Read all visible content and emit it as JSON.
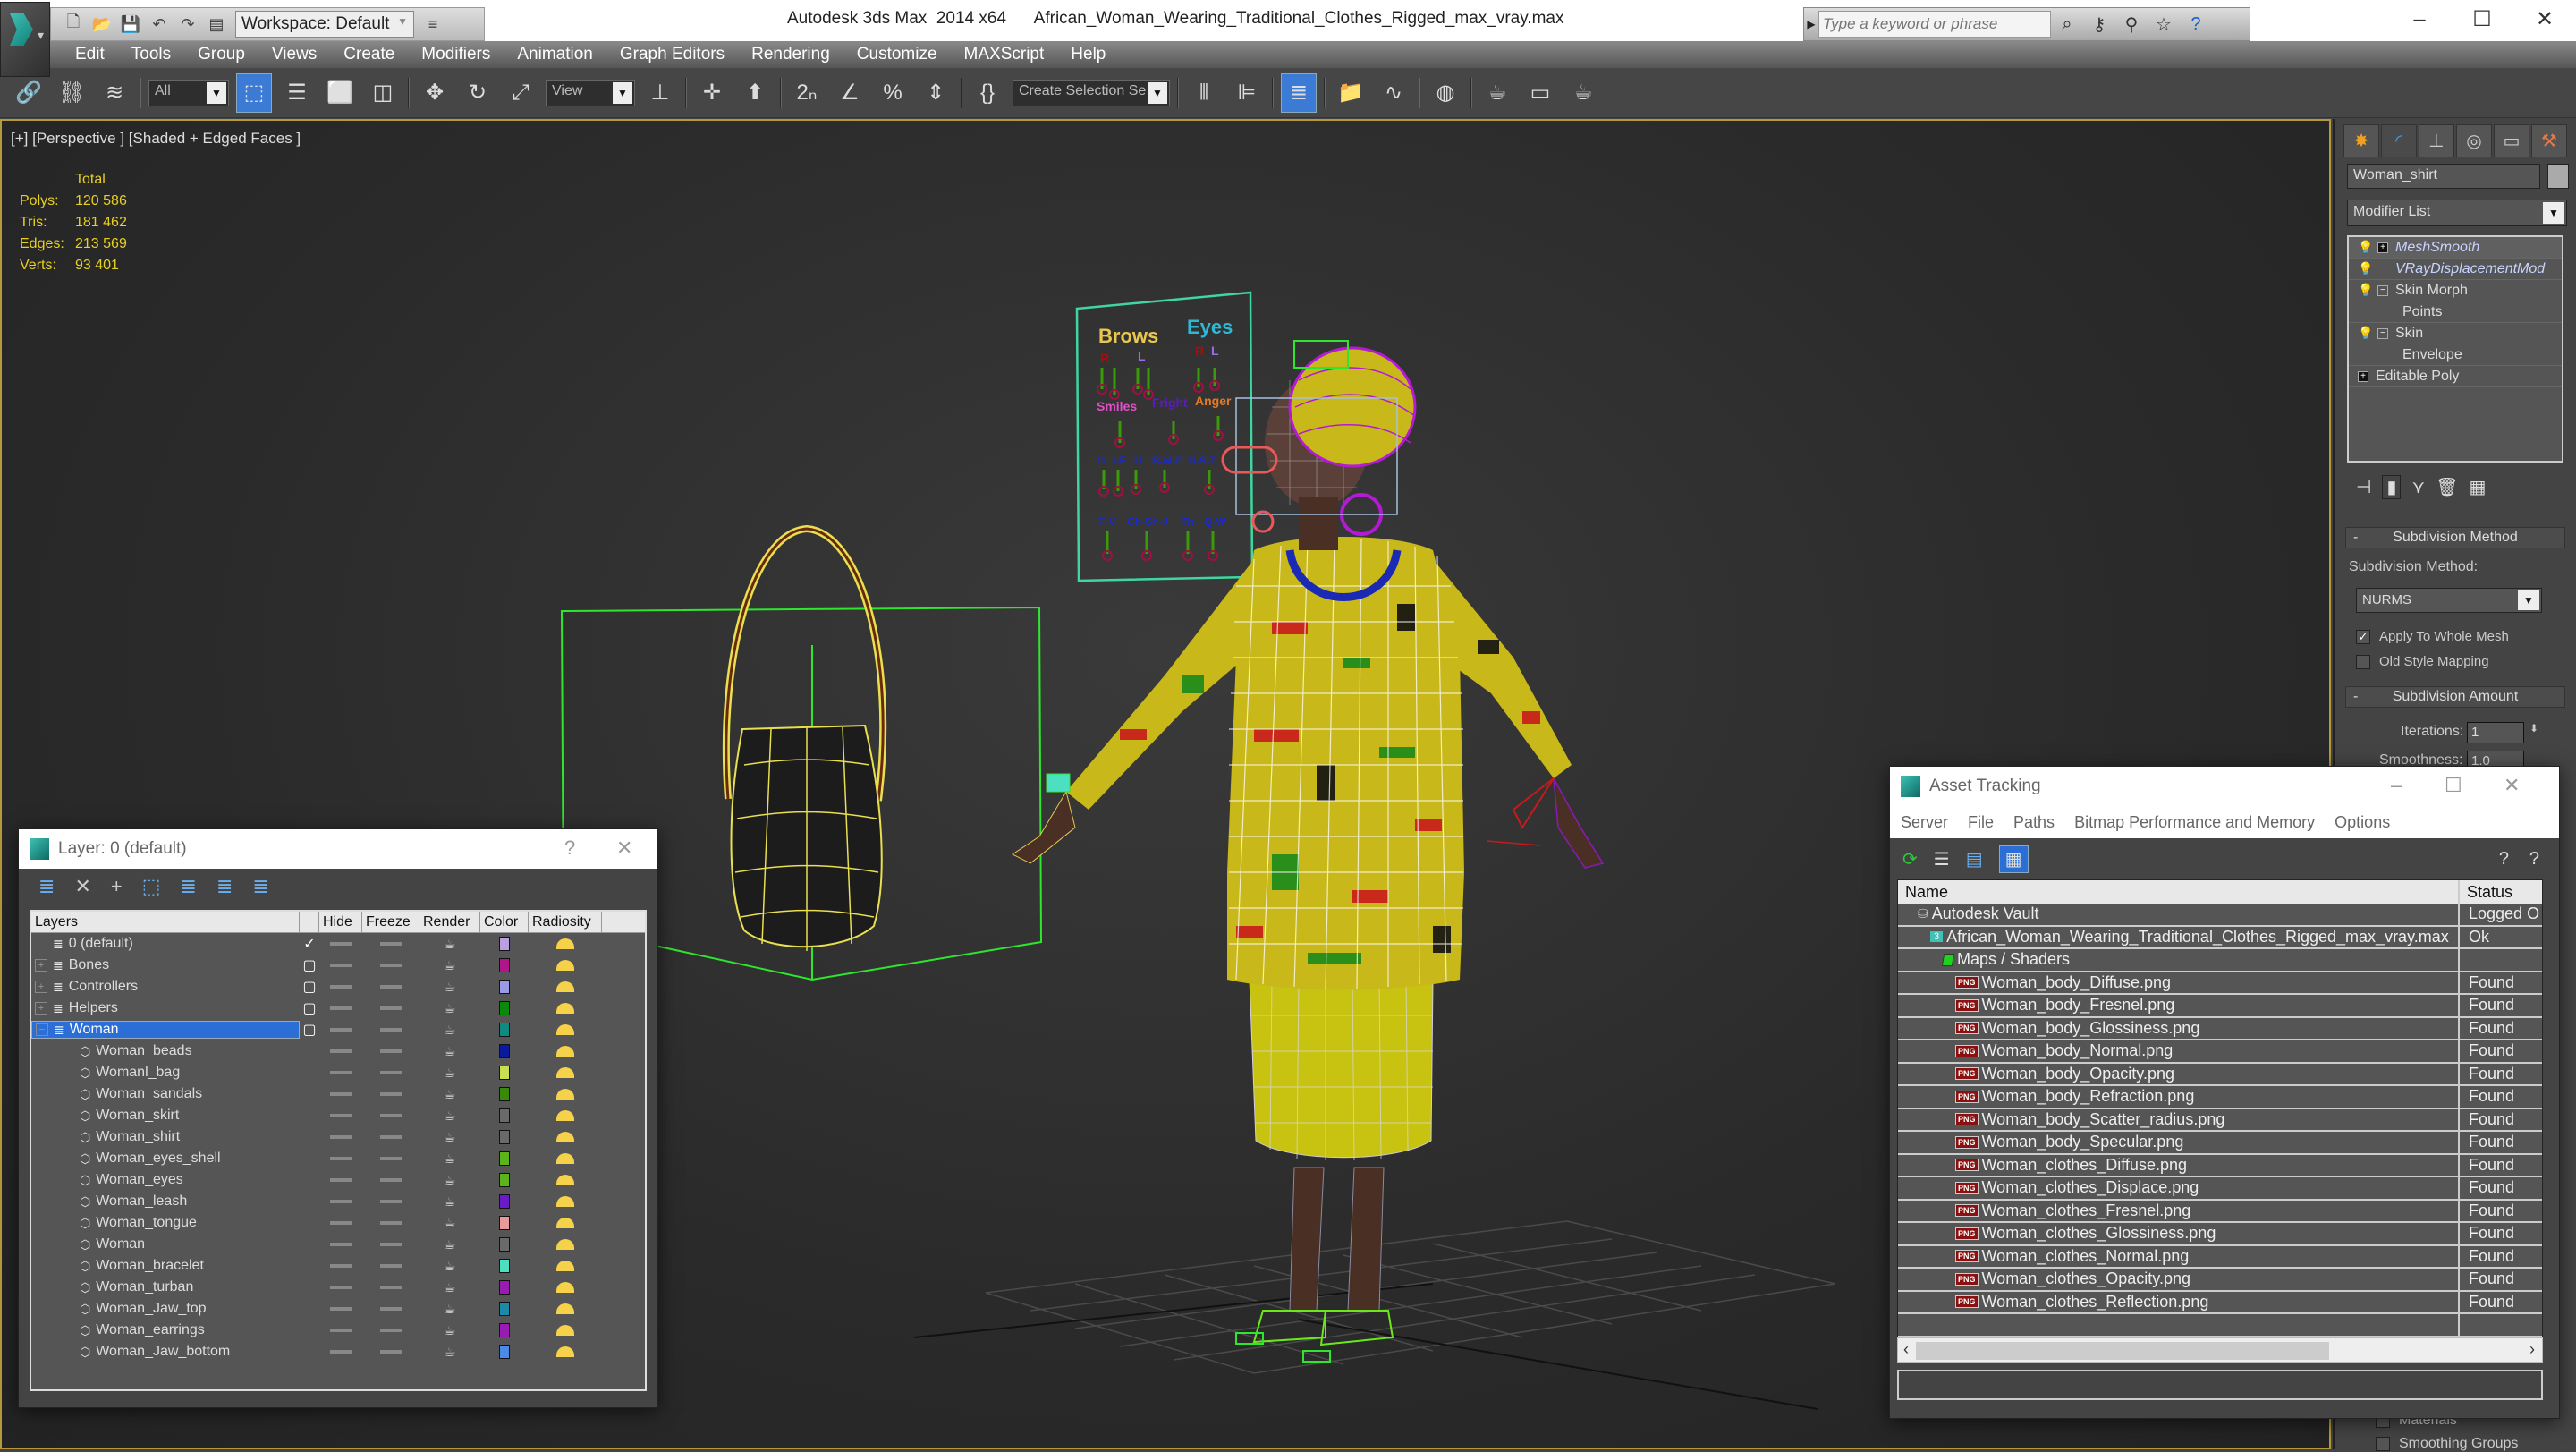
{
  "titlebar": {
    "app_title": "Autodesk 3ds Max  2014 x64",
    "file_name": "African_Woman_Wearing_Traditional_Clothes_Rigged_max_vray.max",
    "workspace": "Workspace: Default",
    "search_placeholder": "Type a keyword or phrase",
    "window_controls": [
      "–",
      "☐",
      "✕"
    ]
  },
  "menubar": {
    "items": [
      "Edit",
      "Tools",
      "Group",
      "Views",
      "Create",
      "Modifiers",
      "Animation",
      "Graph Editors",
      "Rendering",
      "Customize",
      "MAXScript",
      "Help"
    ]
  },
  "toolbar": {
    "selection_filter": "All",
    "reference_coord": "View",
    "named_selection": "Create Selection Se"
  },
  "viewport": {
    "label": "[+] [Perspective ] [Shaded + Edged Faces ]",
    "stats": {
      "header": "Total",
      "rows": [
        {
          "label": "Polys:",
          "value": "120 586"
        },
        {
          "label": "Tris:",
          "value": "181 462"
        },
        {
          "label": "Edges:",
          "value": "213 569"
        },
        {
          "label": "Verts:",
          "value": "93 401"
        }
      ]
    },
    "face_rig": {
      "brows": "Brows",
      "eyes": "Eyes",
      "r": "R",
      "l": "L",
      "smiles": "Smiles",
      "fright": "Fright",
      "anger": "Anger",
      "visemes_row1": [
        "O",
        "I-E",
        "U",
        "B-M-P",
        "D-S-T"
      ],
      "visemes_row2": [
        "F-V",
        "Ch-Sh-J",
        "Th",
        "Q-W"
      ]
    }
  },
  "command_panel": {
    "object_name": "Woman_shirt",
    "modifier_list": "Modifier List",
    "stack": [
      {
        "label": "MeshSmooth",
        "italic": true,
        "toggle": "+"
      },
      {
        "label": "VRayDisplacementMod",
        "italic": true,
        "toggle": ""
      },
      {
        "label": "Skin Morph",
        "italic": false,
        "toggle": "−"
      },
      {
        "label": "Points",
        "sub": true
      },
      {
        "label": "Skin",
        "italic": false,
        "toggle": "−"
      },
      {
        "label": "Envelope",
        "sub": true
      },
      {
        "label": "Editable Poly",
        "italic": false,
        "toggle": "+",
        "nobulb": true
      }
    ],
    "subdivision_method_title": "Subdivision Method",
    "subdivision_method_label": "Subdivision Method:",
    "subdivision_method_value": "NURMS",
    "apply_whole_mesh": {
      "label": "Apply To Whole Mesh",
      "checked": true
    },
    "old_style_mapping": {
      "label": "Old Style Mapping",
      "checked": false
    },
    "subdivision_amount_title": "Subdivision Amount",
    "iterations_label": "Iterations:",
    "iterations_value": "1",
    "smoothness_label": "Smoothness:",
    "smoothness_value": "1.0",
    "materials_label": "Materials",
    "smoothing_groups_label": "Smoothing Groups"
  },
  "layer_dialog": {
    "title": "Layer: 0 (default)",
    "help": "?",
    "close": "✕",
    "columns": [
      "Layers",
      "",
      "Hide",
      "Freeze",
      "Render",
      "Color",
      "Radiosity"
    ],
    "layers": [
      {
        "name": "0 (default)",
        "type": "layer",
        "current": true,
        "color": "#b9a0e0"
      },
      {
        "name": "Bones",
        "type": "layer",
        "expander": "+",
        "color": "#b0168a"
      },
      {
        "name": "Controllers",
        "type": "layer",
        "expander": "+",
        "color": "#9a9ae6"
      },
      {
        "name": "Helpers",
        "type": "layer",
        "expander": "+",
        "color": "#0a8a0a"
      },
      {
        "name": "Woman",
        "type": "layer",
        "expander": "−",
        "selected": true,
        "color": "#0e8a80"
      },
      {
        "name": "Woman_beads",
        "type": "object",
        "color": "#0a1aa0"
      },
      {
        "name": "Womanl_bag",
        "type": "object",
        "color": "#c8e050"
      },
      {
        "name": "Woman_sandals",
        "type": "object",
        "color": "#3a8a0a"
      },
      {
        "name": "Woman_skirt",
        "type": "object",
        "color": "#6a6a6a"
      },
      {
        "name": "Woman_shirt",
        "type": "object",
        "color": "#6a6a6a"
      },
      {
        "name": "Woman_eyes_shell",
        "type": "object",
        "color": "#5ab41a"
      },
      {
        "name": "Woman_eyes",
        "type": "object",
        "color": "#5ab41a"
      },
      {
        "name": "Woman_leash",
        "type": "object",
        "color": "#6a1ac8"
      },
      {
        "name": "Woman_tongue",
        "type": "object",
        "color": "#e89a9a"
      },
      {
        "name": "Woman",
        "type": "object",
        "color": "#6a6a6a"
      },
      {
        "name": "Woman_bracelet",
        "type": "object",
        "color": "#4ae0c0"
      },
      {
        "name": "Woman_turban",
        "type": "object",
        "color": "#9a1ab4"
      },
      {
        "name": "Woman_Jaw_top",
        "type": "object",
        "color": "#1a8aa8"
      },
      {
        "name": "Woman_earrings",
        "type": "object",
        "color": "#9a1ab4"
      },
      {
        "name": "Woman_Jaw_bottom",
        "type": "object",
        "color": "#4a8ae8"
      }
    ]
  },
  "asset_tracking": {
    "title": "Asset Tracking",
    "menu": [
      "Server",
      "File",
      "Paths",
      "Bitmap Performance and Memory",
      "Options"
    ],
    "columns": {
      "name": "Name",
      "status": "Status"
    },
    "rows": [
      {
        "name": "Autodesk Vault",
        "status": "Logged O",
        "icon": "vault",
        "indent": 1
      },
      {
        "name": "African_Woman_Wearing_Traditional_Clothes_Rigged_max_vray.max",
        "status": "Ok",
        "icon": "max",
        "indent": 2
      },
      {
        "name": "Maps / Shaders",
        "status": "",
        "icon": "maps",
        "indent": 3
      },
      {
        "name": "Woman_body_Diffuse.png",
        "status": "Found",
        "icon": "png",
        "indent": 4
      },
      {
        "name": "Woman_body_Fresnel.png",
        "status": "Found",
        "icon": "png",
        "indent": 4
      },
      {
        "name": "Woman_body_Glossiness.png",
        "status": "Found",
        "icon": "png",
        "indent": 4
      },
      {
        "name": "Woman_body_Normal.png",
        "status": "Found",
        "icon": "png",
        "indent": 4
      },
      {
        "name": "Woman_body_Opacity.png",
        "status": "Found",
        "icon": "png",
        "indent": 4
      },
      {
        "name": "Woman_body_Refraction.png",
        "status": "Found",
        "icon": "png",
        "indent": 4
      },
      {
        "name": "Woman_body_Scatter_radius.png",
        "status": "Found",
        "icon": "png",
        "indent": 4
      },
      {
        "name": "Woman_body_Specular.png",
        "status": "Found",
        "icon": "png",
        "indent": 4
      },
      {
        "name": "Woman_clothes_Diffuse.png",
        "status": "Found",
        "icon": "png",
        "indent": 4
      },
      {
        "name": "Woman_clothes_Displace.png",
        "status": "Found",
        "icon": "png",
        "indent": 4
      },
      {
        "name": "Woman_clothes_Fresnel.png",
        "status": "Found",
        "icon": "png",
        "indent": 4
      },
      {
        "name": "Woman_clothes_Glossiness.png",
        "status": "Found",
        "icon": "png",
        "indent": 4
      },
      {
        "name": "Woman_clothes_Normal.png",
        "status": "Found",
        "icon": "png",
        "indent": 4
      },
      {
        "name": "Woman_clothes_Opacity.png",
        "status": "Found",
        "icon": "png",
        "indent": 4
      },
      {
        "name": "Woman_clothes_Reflection.png",
        "status": "Found",
        "icon": "png",
        "indent": 4
      },
      {
        "name": "",
        "status": "",
        "icon": "",
        "indent": 0
      },
      {
        "name": "",
        "status": "",
        "icon": "",
        "indent": 0
      }
    ],
    "scroll_fraction": 0.66
  },
  "colors": {
    "viewport_border": "#b49a3a",
    "stats_text": "#e8d020",
    "selection_blue": "#2b6fd6"
  }
}
